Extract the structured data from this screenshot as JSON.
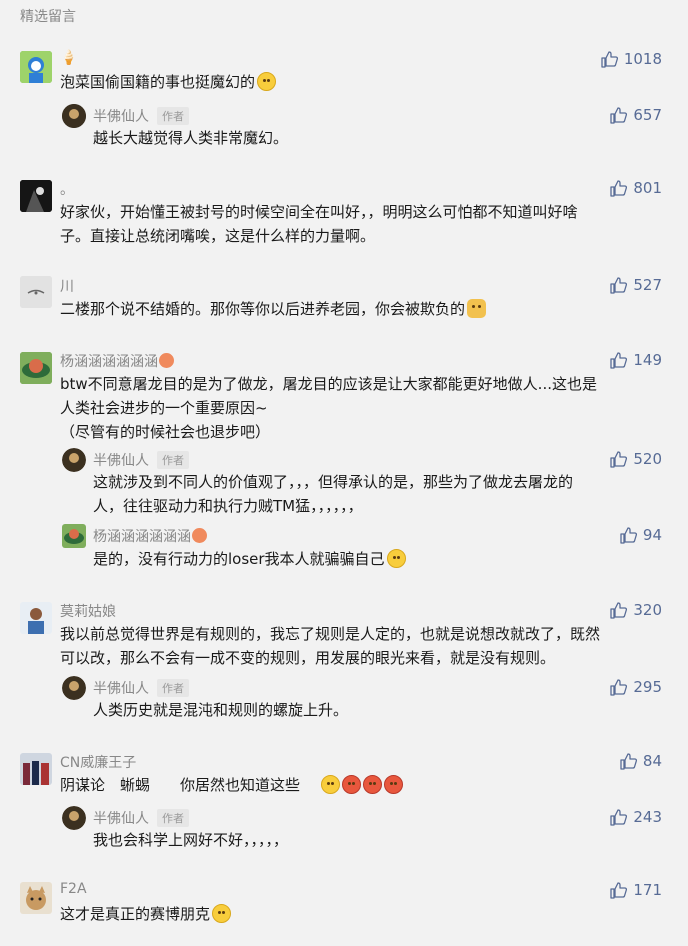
{
  "section_title": "精选留言",
  "comments": [
    {
      "user": "🍦",
      "text": "泡菜国偷国籍的事也挺魔幻的",
      "likes": "1018"
    },
    {
      "user": "半佛仙人",
      "tag": "作者",
      "text": "越长大越觉得人类非常魔幻。",
      "likes": "657"
    },
    {
      "user": "。",
      "text_lines": [
        "好家伙，开始懂王被封号的时候空间全在叫好，，明明这么可怕都不知道叫好啥",
        "子。直接让总统闭嘴唉，这是什么样的力量啊。"
      ],
      "likes": "801"
    },
    {
      "user": "川",
      "text": "二楼那个说不结婚的。那你等你以后进养老园，你会被欺负的",
      "likes": "527"
    },
    {
      "user": "杨涵涵涵涵涵涵",
      "text_lines": [
        "btw不同意屠龙目的是为了做龙，屠龙目的应该是让大家都能更好地做人...这也是",
        "人类社会进步的一个重要原因~",
        "（尽管有的时候社会也退步吧）"
      ],
      "likes": "149"
    },
    {
      "user": "半佛仙人",
      "tag": "作者",
      "text_lines": [
        "这就涉及到不同人的价值观了，，，但得承认的是，那些为了做龙去屠龙的",
        "人，往往驱动力和执行力贼TM猛，，，，，，"
      ],
      "likes": "520"
    },
    {
      "user": "杨涵涵涵涵涵涵",
      "text": "是的，没有行动力的loser我本人就骗骗自己",
      "likes": "94"
    },
    {
      "user": "莫莉姑娘",
      "text_lines": [
        "我以前总觉得世界是有规则的，我忘了规则是人定的，也就是说想改就改了，既然",
        "可以改，那么不会有一成不变的规则，用发展的眼光来看，就是没有规则。"
      ],
      "likes": "320"
    },
    {
      "user": "半佛仙人",
      "tag": "作者",
      "text": "人类历史就是混沌和规则的螺旋上升。",
      "likes": "295"
    },
    {
      "user": "CN威廉王子",
      "text": "阴谋论　蜥蜴　　你居然也知道这些",
      "likes": "84"
    },
    {
      "user": "半佛仙人",
      "tag": "作者",
      "text": "我也会科学上网好不好，，，，，",
      "likes": "243"
    },
    {
      "user": "F2A",
      "text": "这才是真正的赛博朋克",
      "likes": "171"
    }
  ],
  "icons": {
    "like": "thumbs-up-icon"
  },
  "colors": {
    "like": "#576b95",
    "name": "#888888"
  }
}
